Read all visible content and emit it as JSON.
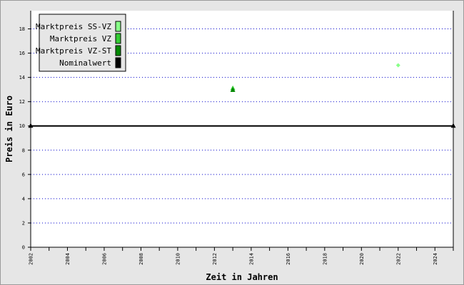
{
  "chart_data": {
    "type": "scatter",
    "xlabel": "Zeit in Jahren",
    "ylabel": "Preis in Euro",
    "xlim": [
      2002,
      2025
    ],
    "ylim": [
      0,
      19.5
    ],
    "x_ticks": [
      2002,
      2004,
      2006,
      2008,
      2010,
      2012,
      2014,
      2016,
      2018,
      2020,
      2022,
      2024
    ],
    "y_ticks": [
      0,
      2,
      4,
      6,
      8,
      10,
      12,
      14,
      16,
      18
    ],
    "grid": "horizontal-dotted",
    "legend_position": "top-left",
    "series": [
      {
        "name": "Marktpreis SS-VZ",
        "color": "#88ff88",
        "marker": "diamond",
        "points": [
          {
            "x": 2022,
            "y": 15
          }
        ]
      },
      {
        "name": "Marktpreis VZ",
        "color": "#33cc33",
        "marker": "triangle",
        "points": [
          {
            "x": 2013,
            "y": 13.1
          }
        ]
      },
      {
        "name": "Marktpreis VZ-ST",
        "color": "#008800",
        "marker": "triangle",
        "points": [
          {
            "x": 2013,
            "y": 12.95
          }
        ]
      },
      {
        "name": "Nominalwert",
        "color": "#000000",
        "marker": "triangle",
        "line": true,
        "points": [
          {
            "x": 2002,
            "y": 10
          },
          {
            "x": 2025,
            "y": 10
          }
        ]
      }
    ]
  }
}
